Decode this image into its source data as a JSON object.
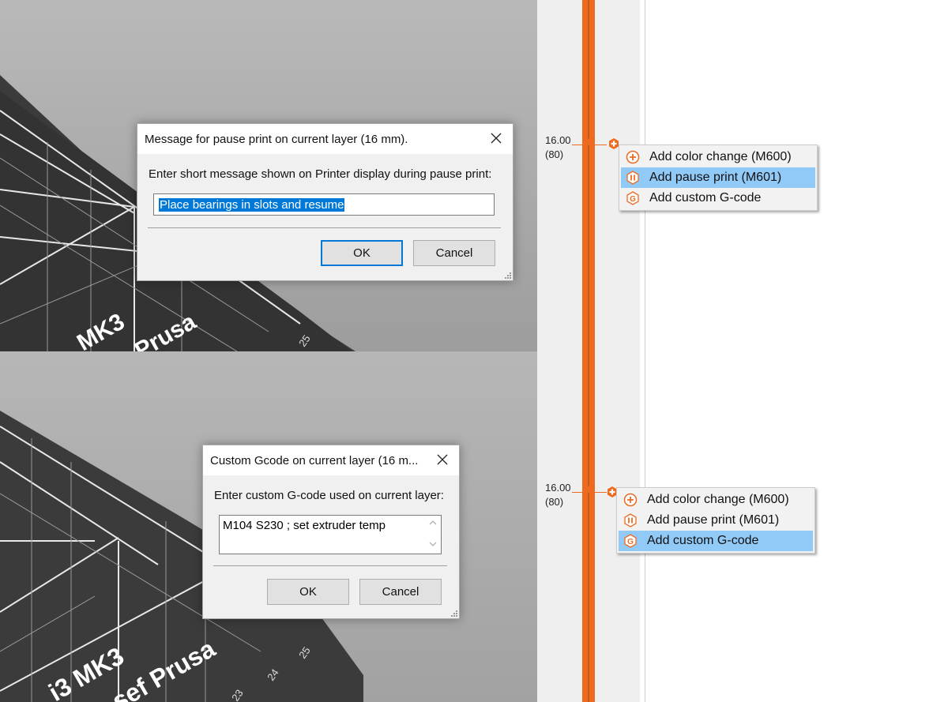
{
  "colors": {
    "accent": "#ed6b21",
    "selection": "#91c9f7",
    "bed": "#3a3a3a"
  },
  "bed_text": {
    "top_model": "MK3",
    "top_maker": "Prusa",
    "top_tick": "25",
    "bottom_model": "i3 MK3",
    "bottom_maker": "sef Prusa",
    "bottom_ticks": [
      "25",
      "24",
      "23"
    ]
  },
  "slider_top": {
    "value": "16.00",
    "layer": "(80)"
  },
  "slider_bottom": {
    "value": "16.00",
    "layer": "(80)"
  },
  "menu_top": {
    "items": [
      {
        "label": "Add color change (M600)",
        "icon": "plus-circle-icon",
        "selected": false
      },
      {
        "label": "Add pause print (M601)",
        "icon": "pause-hex-icon",
        "selected": true
      },
      {
        "label": "Add custom G-code",
        "icon": "g-hex-icon",
        "selected": false
      }
    ]
  },
  "menu_bottom": {
    "items": [
      {
        "label": "Add color change (M600)",
        "icon": "plus-circle-icon",
        "selected": false
      },
      {
        "label": "Add pause print (M601)",
        "icon": "pause-hex-icon",
        "selected": false
      },
      {
        "label": "Add custom G-code",
        "icon": "g-hex-icon",
        "selected": true
      }
    ]
  },
  "pause_dialog": {
    "title": "Message for pause print on current layer (16 mm).",
    "prompt": "Enter short message shown on Printer display during pause print:",
    "value": "Place bearings in slots and resume",
    "ok": "OK",
    "cancel": "Cancel"
  },
  "gcode_dialog": {
    "title": "Custom Gcode on current layer (16 m...",
    "prompt": "Enter custom G-code used on current layer:",
    "value": "M104 S230 ; set extruder temp",
    "ok": "OK",
    "cancel": "Cancel"
  }
}
